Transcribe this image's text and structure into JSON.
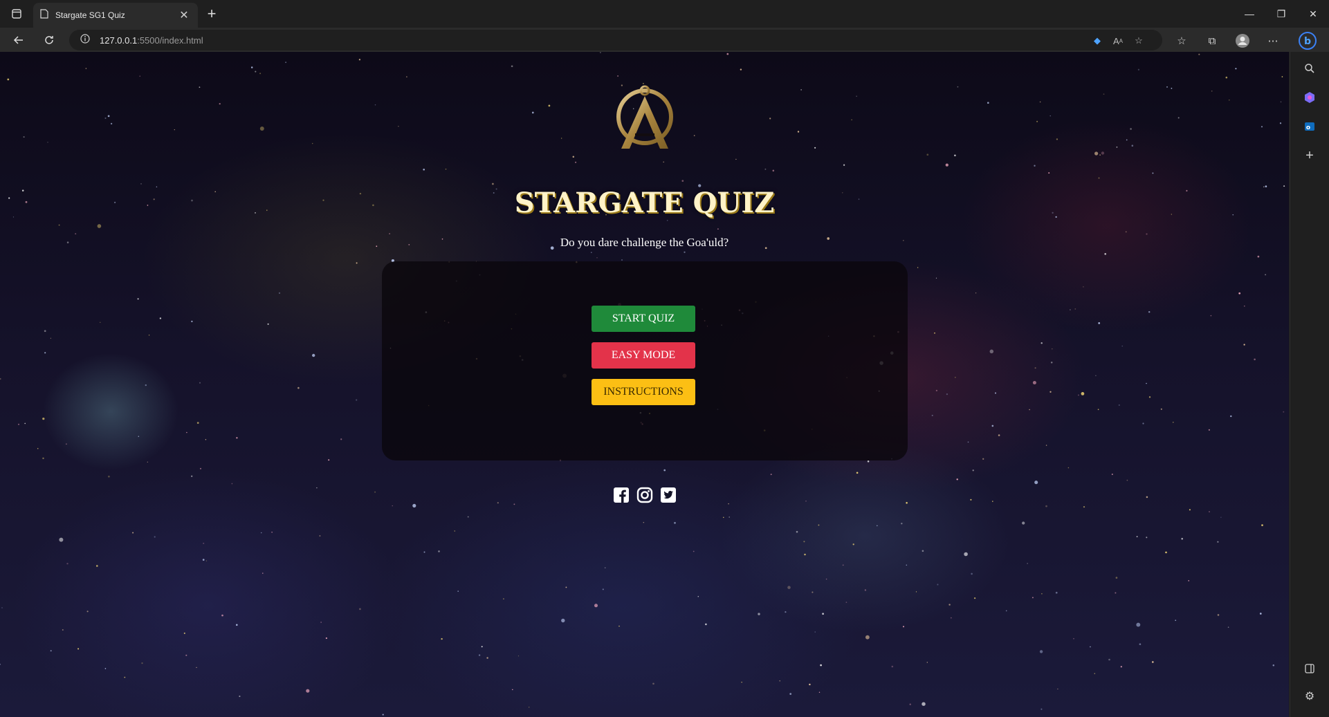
{
  "browser": {
    "tab_title": "Stargate SG1 Quiz",
    "url_host": "127.0.0.1",
    "url_rest": ":5500/index.html"
  },
  "page": {
    "title": "STARGATE QUIZ",
    "subtitle": "Do you dare challenge the Goa'uld?",
    "buttons": {
      "start": "START QUIZ",
      "easy": "EASY MODE",
      "instructions": "INSTRUCTIONS"
    },
    "social": [
      "facebook-icon",
      "instagram-icon",
      "twitter-icon"
    ]
  },
  "colors": {
    "start": "#1f8a3a",
    "easy": "#e3334a",
    "instructions": "#fcbf14",
    "title": "#fff3c8",
    "logo_gold": "#b89a5a"
  }
}
